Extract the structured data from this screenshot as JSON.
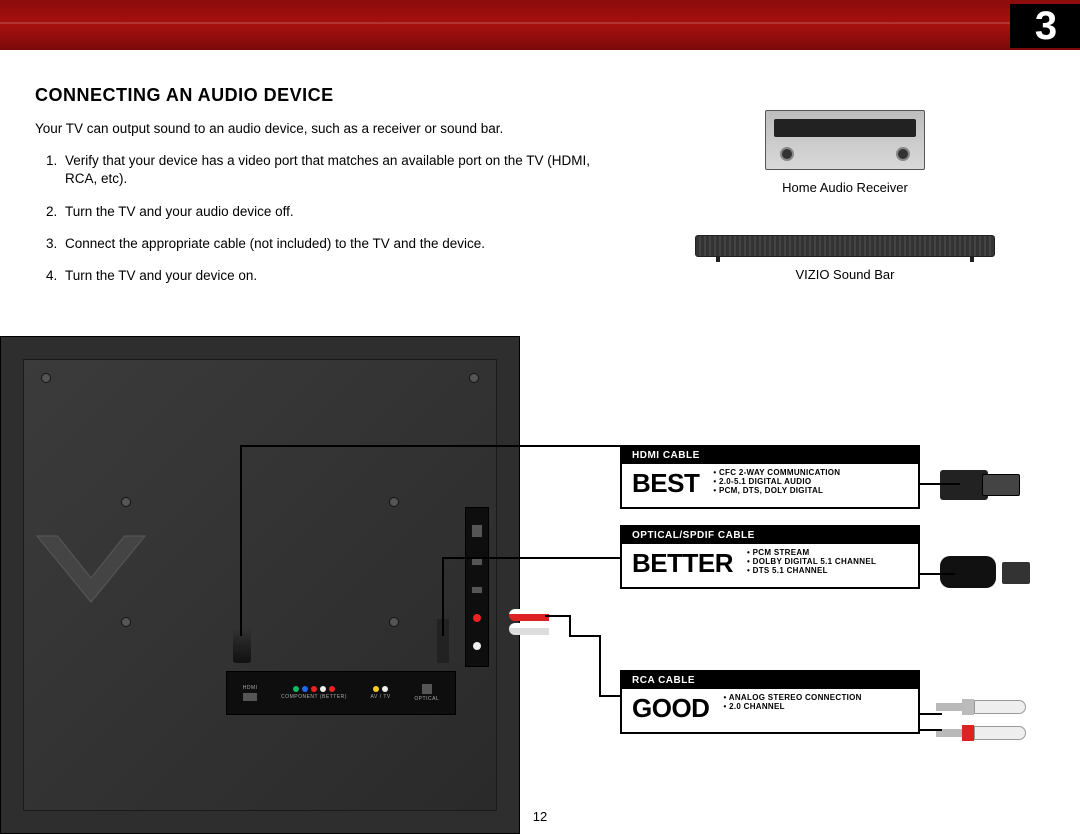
{
  "page": {
    "chapter_number": "3",
    "page_number": "12",
    "heading": "CONNECTING AN AUDIO DEVICE",
    "intro": "Your TV can output sound to an audio device, such as a receiver or sound bar.",
    "steps": [
      "Verify that your device has a video port that matches an available port on the TV (HDMI, RCA, etc).",
      "Turn the TV and your audio device off.",
      "Connect the appropriate cable (not included) to the TV and the device.",
      "Turn the TV and your device on."
    ]
  },
  "devices": {
    "receiver_label": "Home Audio Receiver",
    "soundbar_label": "VIZIO Sound Bar"
  },
  "cables": {
    "best": {
      "header": "HDMI CABLE",
      "rank": "BEST",
      "bullets": [
        "CFC 2-WAY COMMUNICATION",
        "2.0-5.1 DIGITAL AUDIO",
        "PCM, DTS, DOLY DIGITAL"
      ]
    },
    "better": {
      "header": "OPTICAL/SPDIF CABLE",
      "rank": "BETTER",
      "bullets": [
        "PCM STREAM",
        "DOLBY DIGITAL 5.1 CHANNEL",
        "DTS 5.1 CHANNEL"
      ]
    },
    "good": {
      "header": "RCA CABLE",
      "rank": "GOOD",
      "bullets": [
        "ANALOG STEREO CONNECTION",
        "2.0 CHANNEL"
      ]
    }
  },
  "port_labels": {
    "component": "COMPONENT (BETTER)",
    "av": "AV / TV",
    "optical": "OPTICAL",
    "hdmi": "HDMI"
  }
}
